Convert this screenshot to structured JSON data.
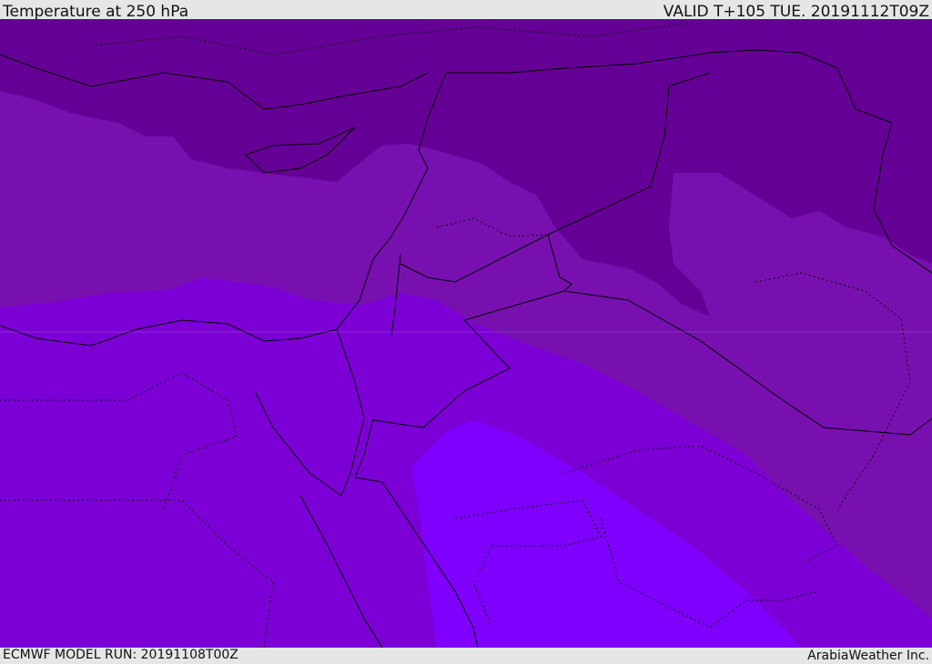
{
  "header": {
    "title": "Temperature at 250 hPa",
    "valid": "VALID T+105 TUE. 20191112T09Z"
  },
  "footer": {
    "model_run": "ECMWF MODEL RUN: 20191108T00Z",
    "credit": "ArabiaWeather Inc."
  },
  "colors": {
    "band_coldest": "#650096",
    "band_cold": "#7810b0",
    "band_mid": "#7c00d6",
    "band_warm": "#7f00ff",
    "border": "#000000"
  }
}
